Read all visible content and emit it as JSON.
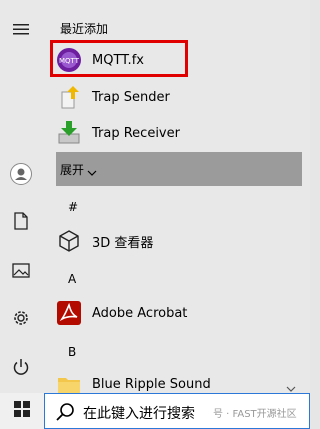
{
  "list": {
    "recent_header": "最近添加",
    "recent": [
      {
        "label": "MQTT.fx",
        "icon": "mqttfx-icon"
      },
      {
        "label": "Trap Sender",
        "icon": "trap-sender-icon"
      },
      {
        "label": "Trap Receiver",
        "icon": "trap-receiver-icon"
      }
    ],
    "expand_label": "展开",
    "groups": [
      {
        "letter": "#",
        "items": [
          {
            "label": "3D 查看器",
            "icon": "3d-viewer-icon"
          }
        ]
      },
      {
        "letter": "A",
        "items": [
          {
            "label": "Adobe Acrobat",
            "icon": "adobe-acrobat-icon"
          }
        ]
      },
      {
        "letter": "B",
        "items": [
          {
            "label": "Blue Ripple Sound",
            "icon": "folder-icon"
          }
        ]
      }
    ]
  },
  "taskbar": {
    "search_placeholder": "在此键入进行搜索",
    "watermark": "号 · FAST开源社区"
  },
  "colors": {
    "highlight": "#e10000",
    "acrobat": "#b30b00",
    "folder": "#f3c64c"
  }
}
